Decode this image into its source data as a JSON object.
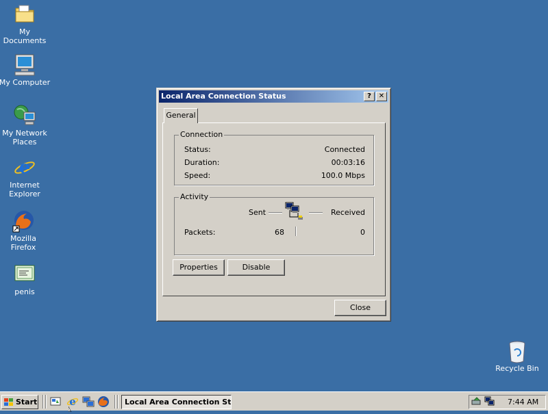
{
  "desktop": {
    "icons": [
      {
        "label": "My Documents",
        "icon": "folder-documents-icon"
      },
      {
        "label": "My Computer",
        "icon": "computer-icon"
      },
      {
        "label": "My Network Places",
        "icon": "network-places-icon"
      },
      {
        "label": "Internet Explorer",
        "icon": "internet-explorer-icon"
      },
      {
        "label": "Mozilla Firefox",
        "icon": "firefox-icon"
      },
      {
        "label": "penis",
        "icon": "document-icon"
      },
      {
        "label": "Recycle Bin",
        "icon": "recycle-bin-icon"
      }
    ]
  },
  "dialog": {
    "title": "Local Area Connection Status",
    "help_btn": "?",
    "close_btn": "✕",
    "tab": "General",
    "connection": {
      "legend": "Connection",
      "status_label": "Status:",
      "status_value": "Connected",
      "duration_label": "Duration:",
      "duration_value": "00:03:16",
      "speed_label": "Speed:",
      "speed_value": "100.0 Mbps"
    },
    "activity": {
      "legend": "Activity",
      "sent_label": "Sent",
      "received_label": "Received",
      "packets_label": "Packets:",
      "packets_sent": "68",
      "packets_received": "0"
    },
    "properties_button": "Properties",
    "disable_button": "Disable",
    "close_button": "Close"
  },
  "taskbar": {
    "start_label": "Start",
    "task_label": "Local Area Connection St...",
    "clock": "7:44 AM"
  },
  "colors": {
    "desktop": "#3a6ea5",
    "title_start": "#0a246a",
    "title_end": "#a6caf0",
    "face": "#d4d0c8"
  }
}
